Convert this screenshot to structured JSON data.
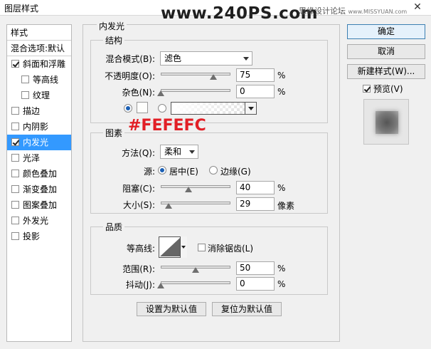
{
  "window": {
    "title": "图层样式",
    "watermark": "www.240PS.com",
    "watermark_sub": "思缘设计论坛",
    "watermark_url": "www.MISSYUAN.com"
  },
  "styles_list": {
    "header": "样式",
    "blend_options": "混合选项:默认",
    "items": [
      {
        "label": "斜面和浮雕",
        "checked": true,
        "sub": false,
        "selected": false
      },
      {
        "label": "等高线",
        "checked": false,
        "sub": true,
        "selected": false
      },
      {
        "label": "纹理",
        "checked": false,
        "sub": true,
        "selected": false
      },
      {
        "label": "描边",
        "checked": false,
        "sub": false,
        "selected": false
      },
      {
        "label": "内阴影",
        "checked": false,
        "sub": false,
        "selected": false
      },
      {
        "label": "内发光",
        "checked": true,
        "sub": false,
        "selected": true
      },
      {
        "label": "光泽",
        "checked": false,
        "sub": false,
        "selected": false
      },
      {
        "label": "颜色叠加",
        "checked": false,
        "sub": false,
        "selected": false
      },
      {
        "label": "渐变叠加",
        "checked": false,
        "sub": false,
        "selected": false
      },
      {
        "label": "图案叠加",
        "checked": false,
        "sub": false,
        "selected": false
      },
      {
        "label": "外发光",
        "checked": false,
        "sub": false,
        "selected": false
      },
      {
        "label": "投影",
        "checked": false,
        "sub": false,
        "selected": false
      }
    ]
  },
  "inner_glow": {
    "title": "内发光",
    "structure": {
      "title": "结构",
      "blend_mode_label": "混合模式(B):",
      "blend_mode_value": "滤色",
      "opacity_label": "不透明度(O):",
      "opacity_value": "75",
      "opacity_pct": 0.75,
      "noise_label": "杂色(N):",
      "noise_value": "0",
      "noise_pct": 0,
      "percent": "%",
      "color_hex": "#FEFEFC"
    },
    "annotation": "#FEFEFC",
    "elements": {
      "title": "图素",
      "technique_label": "方法(Q):",
      "technique_value": "柔和",
      "source_label": "源:",
      "center_label": "居中(E)",
      "edge_label": "边缘(G)",
      "choke_label": "阻塞(C):",
      "choke_value": "40",
      "choke_pct": 0.4,
      "size_label": "大小(S):",
      "size_value": "29",
      "size_pct": 0.116,
      "percent": "%",
      "px_unit": "像素"
    },
    "quality": {
      "title": "品质",
      "contour_label": "等高线:",
      "antialias_label": "消除锯齿(L)",
      "range_label": "范围(R):",
      "range_value": "50",
      "range_pct": 0.5,
      "jitter_label": "抖动(J):",
      "jitter_value": "0",
      "jitter_pct": 0,
      "percent": "%"
    },
    "make_default": "设置为默认值",
    "reset_default": "复位为默认值"
  },
  "buttons": {
    "ok": "确定",
    "cancel": "取消",
    "new_style": "新建样式(W)...",
    "preview_label": "预览(V)",
    "preview_checked": true
  },
  "colors": {
    "selected_bg": "#3399ff",
    "annotation": "#e21f26"
  }
}
